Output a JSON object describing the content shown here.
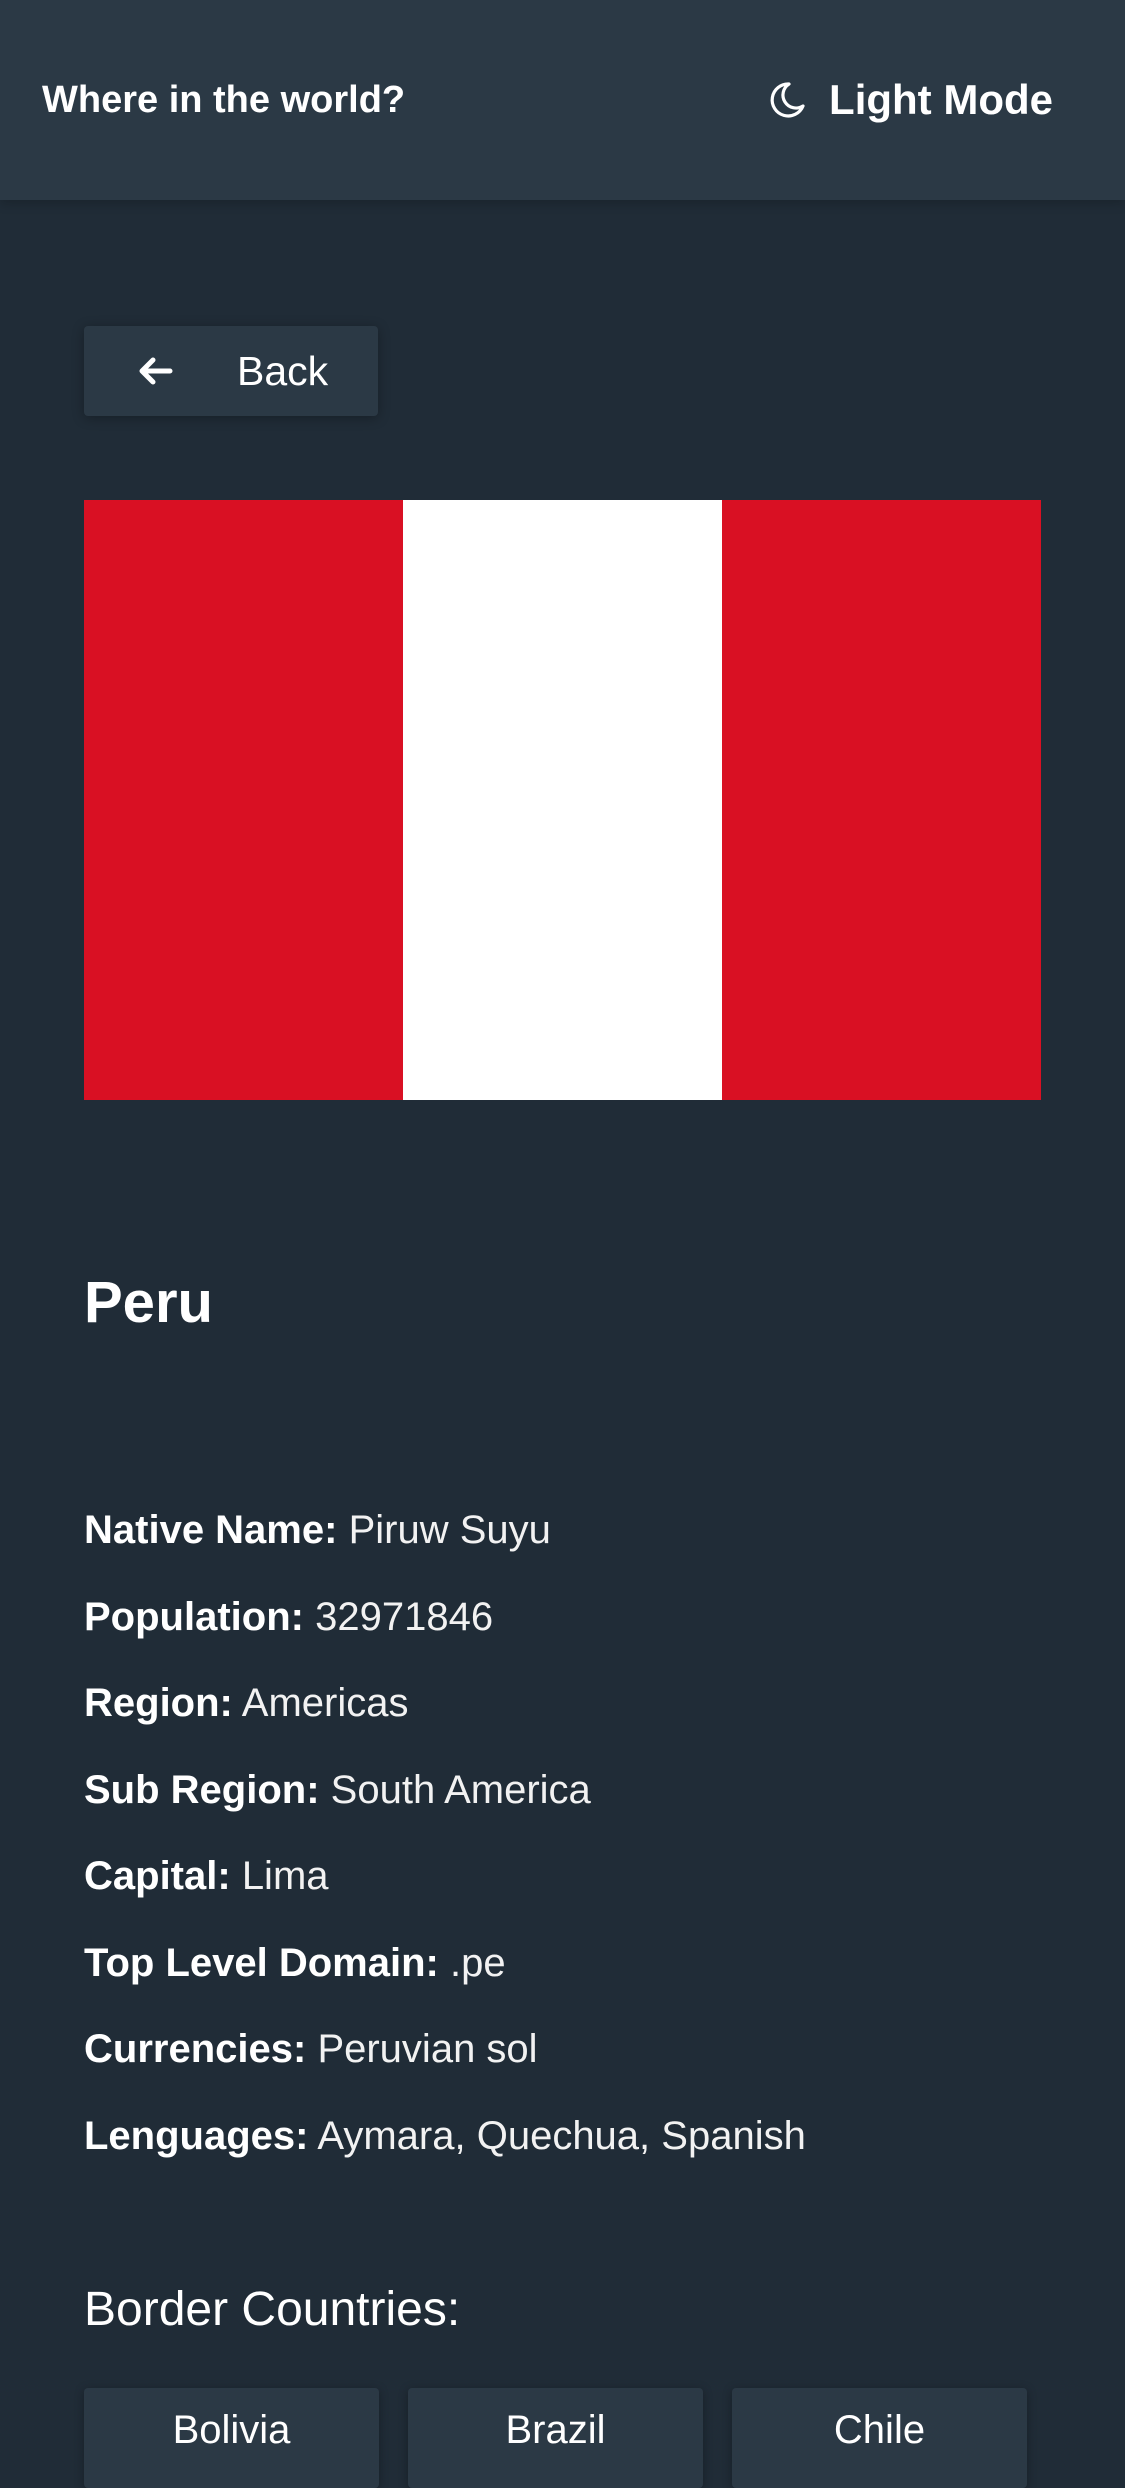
{
  "header": {
    "title": "Where in the world?",
    "mode_toggle": {
      "icon": "moon-icon",
      "label": "Light Mode"
    }
  },
  "back_button": {
    "icon": "arrow-left-icon",
    "label": "Back"
  },
  "flag": {
    "country": "Peru",
    "stripes": [
      "#d91023",
      "#ffffff",
      "#d91023"
    ]
  },
  "country": {
    "name": "Peru",
    "details": [
      {
        "key": "Native Name:",
        "value": "Piruw Suyu"
      },
      {
        "key": "Population:",
        "value": "32971846"
      },
      {
        "key": "Region:",
        "value": "Americas"
      },
      {
        "key": "Sub Region:",
        "value": "South America"
      },
      {
        "key": "Capital:",
        "value": "Lima"
      },
      {
        "key": "Top Level Domain:",
        "value": ".pe"
      },
      {
        "key": "Currencies:",
        "value": "Peruvian sol"
      },
      {
        "key": "Lenguages:",
        "value": "Aymara, Quechua, Spanish"
      }
    ]
  },
  "border_countries": {
    "title": "Border Countries:",
    "items": [
      "Bolivia",
      "Brazil",
      "Chile"
    ]
  },
  "colors": {
    "background": "#202c37",
    "elements": "#2b3945",
    "text": "#ffffff",
    "flag_red": "#d91023"
  }
}
